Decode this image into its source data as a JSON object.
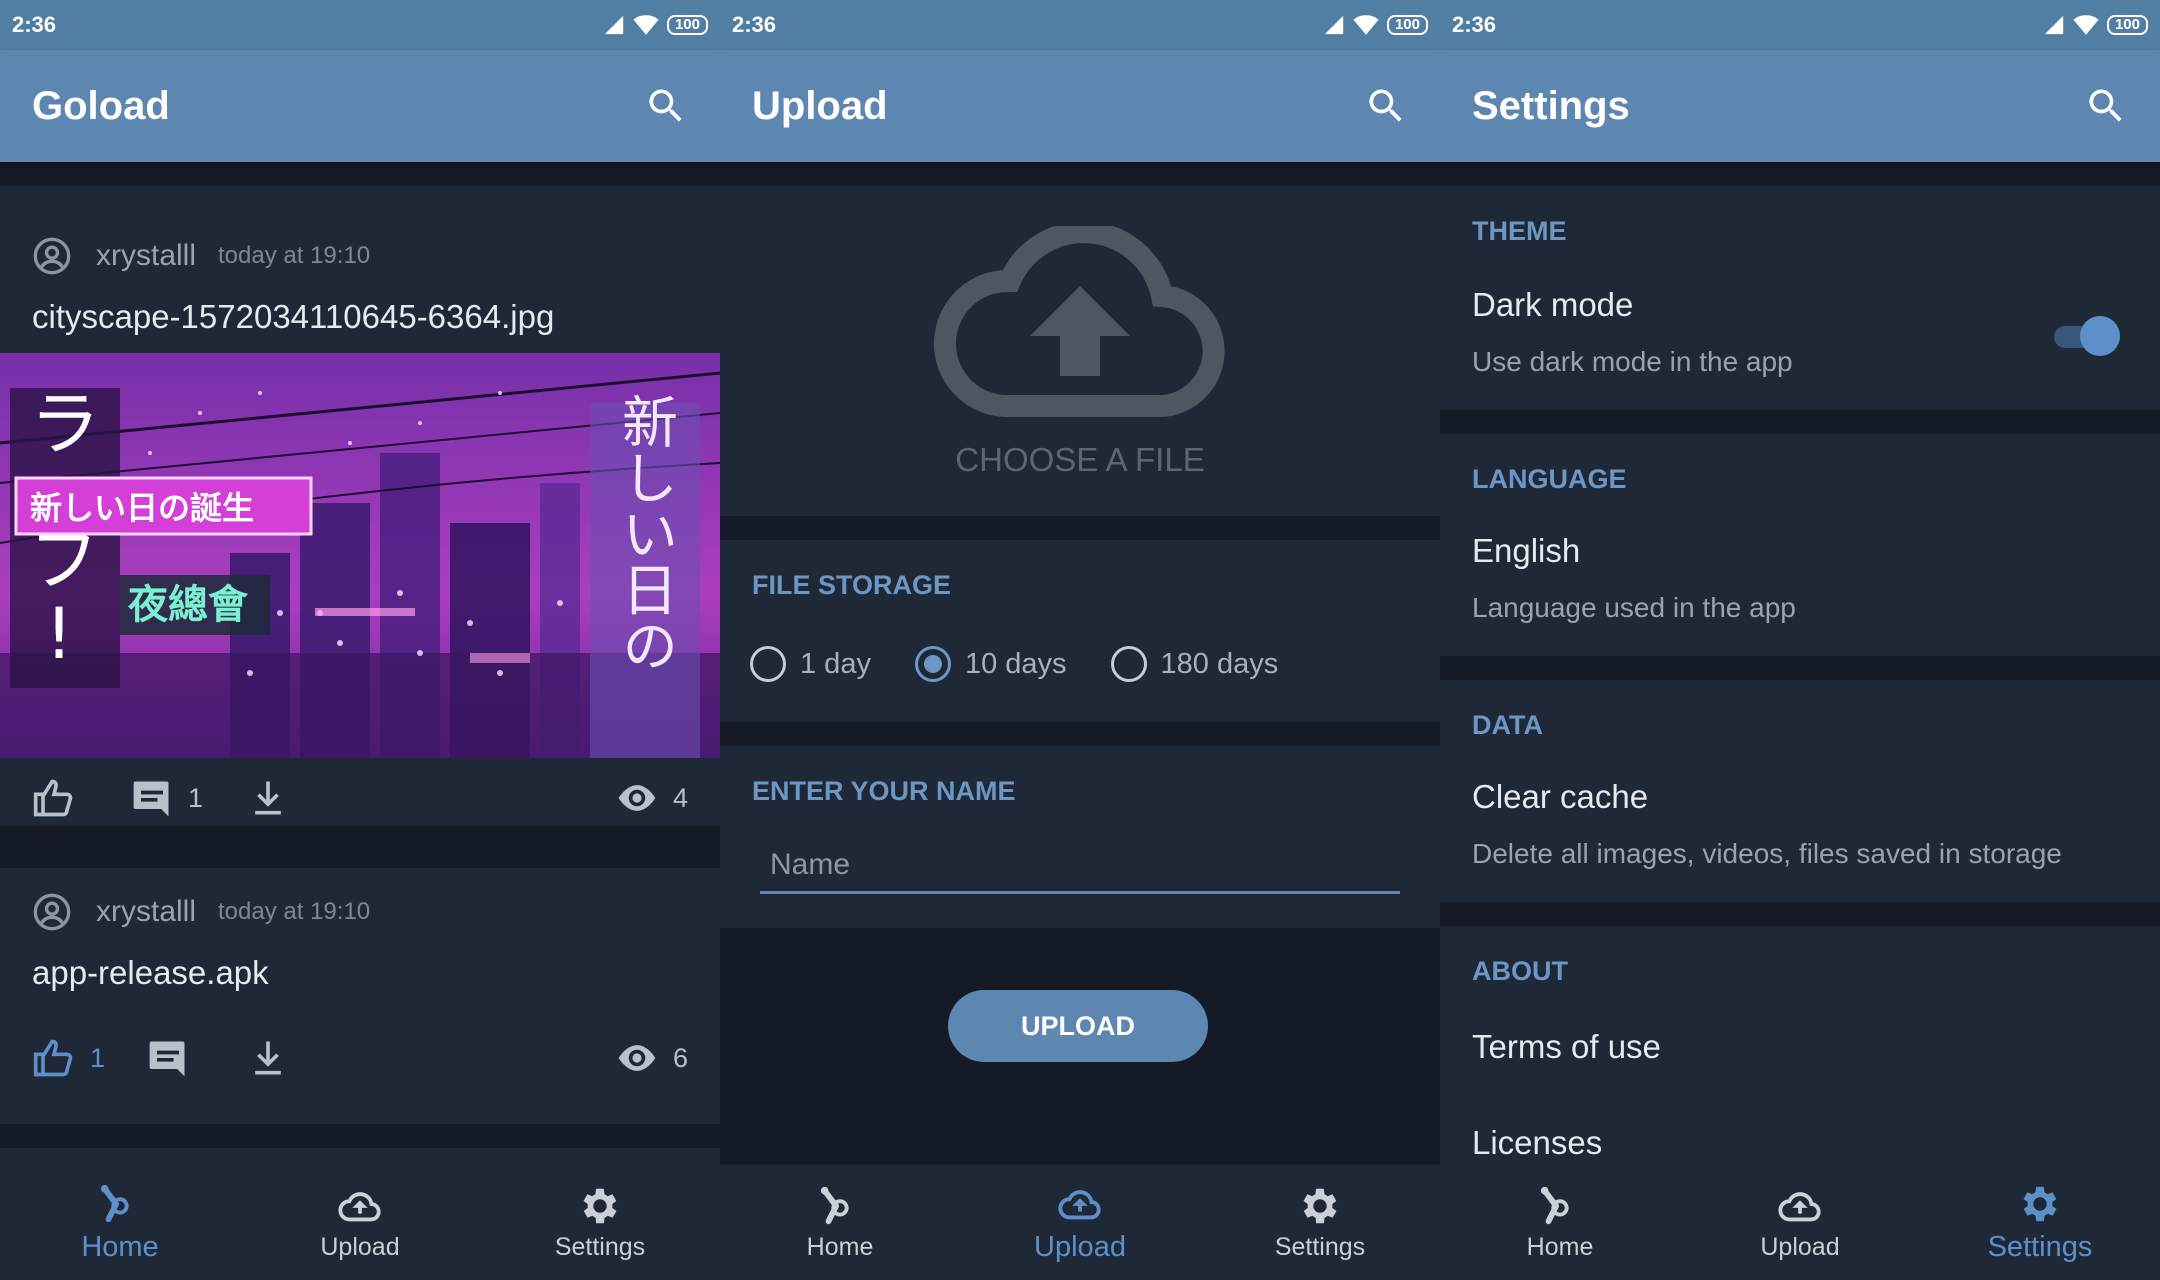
{
  "status": {
    "time": "2:36",
    "battery": "100"
  },
  "home": {
    "title": "Goload",
    "posts": [
      {
        "user": "xrystalll",
        "time": "today at 19:10",
        "file": "cityscape-1572034110645-6364.jpg",
        "comments": "1",
        "views": "4",
        "image_texts": {
          "banner": "新しい日の誕生",
          "vertical": "新しい日の",
          "left": "ラ・ブ！",
          "sign": "夜總會"
        }
      },
      {
        "user": "xrystalll",
        "time": "today at 19:10",
        "file": "app-release.apk",
        "likes": "1",
        "views": "6"
      }
    ]
  },
  "upload": {
    "title": "Upload",
    "choose": "CHOOSE A FILE",
    "storage_label": "FILE STORAGE",
    "options": [
      "1 day",
      "10 days",
      "180 days"
    ],
    "selected": "10 days",
    "name_label": "ENTER YOUR NAME",
    "name_placeholder": "Name",
    "button": "UPLOAD"
  },
  "settings": {
    "title": "Settings",
    "theme_label": "THEME",
    "dark_title": "Dark mode",
    "dark_sub": "Use dark mode in the app",
    "dark_enabled": true,
    "language_label": "LANGUAGE",
    "lang_title": "English",
    "lang_sub": "Language used in the app",
    "data_label": "DATA",
    "cache_title": "Clear cache",
    "cache_sub": "Delete all images, videos, files saved in storage",
    "about_label": "ABOUT",
    "terms": "Terms of use",
    "licenses": "Licenses"
  },
  "nav": {
    "home": "Home",
    "upload": "Upload",
    "settings": "Settings"
  },
  "colors": {
    "statusbar": "#517fa4",
    "appbar": "#5d87b0",
    "background": "#141b26",
    "card": "#1f2836",
    "accent": "#6c97c5"
  }
}
